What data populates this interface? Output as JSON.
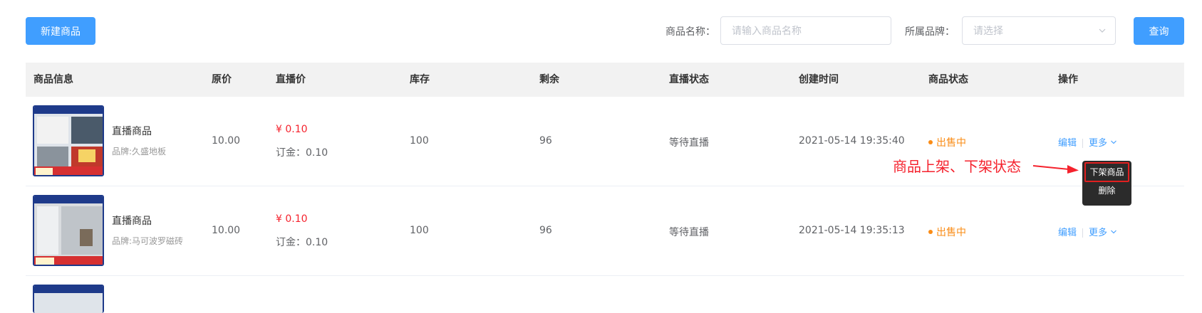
{
  "toolbar": {
    "new_button": "新建商品",
    "name_label": "商品名称：",
    "name_placeholder": "请输入商品名称",
    "brand_label": "所属品牌：",
    "brand_placeholder": "请选择",
    "query_button": "查询"
  },
  "table": {
    "headers": [
      "商品信息",
      "原价",
      "直播价",
      "库存",
      "剩余",
      "直播状态",
      "创建时间",
      "商品状态",
      "操作"
    ],
    "rows": [
      {
        "name": "直播商品",
        "brand": "品牌:久盛地板",
        "original_price": "10.00",
        "live_price": "¥ 0.10",
        "deposit": "订金：0.10",
        "stock": "100",
        "remaining": "96",
        "live_status": "等待直播",
        "created": "2021-05-14 19:35:40",
        "status": "出售中",
        "edit": "编辑",
        "more": "更多"
      },
      {
        "name": "直播商品",
        "brand": "品牌:马可波罗磁砖",
        "original_price": "10.00",
        "live_price": "¥ 0.10",
        "deposit": "订金：0.10",
        "stock": "100",
        "remaining": "96",
        "live_status": "等待直播",
        "created": "2021-05-14 19:35:13",
        "status": "出售中",
        "edit": "编辑",
        "more": "更多"
      }
    ]
  },
  "annotation": "商品上架、下架状态",
  "dropdown": {
    "items": [
      "下架商品",
      "删除"
    ]
  },
  "colors": {
    "primary": "#409eff",
    "price": "#f5222d",
    "status_on": "#fa8c16",
    "annotation": "#f5222d"
  }
}
